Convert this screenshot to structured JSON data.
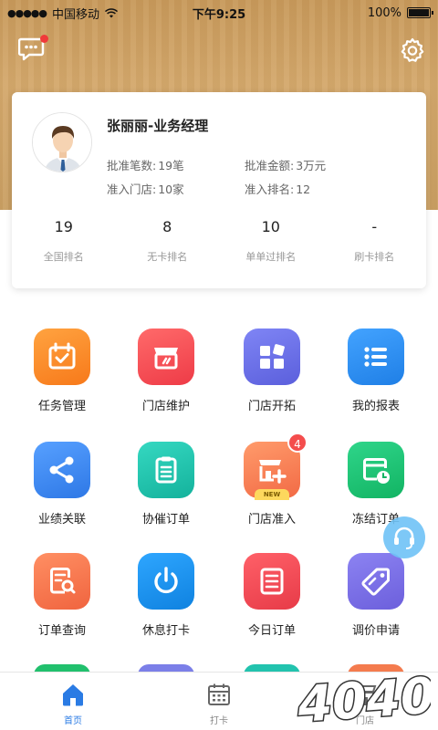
{
  "status_bar": {
    "carrier": "中国移动",
    "time": "下午9:25",
    "battery": "100%"
  },
  "profile": {
    "name_title": "张丽丽-业务经理",
    "details": [
      {
        "label": "批准笔数:",
        "value": "19笔"
      },
      {
        "label": "批准金额:",
        "value": "3万元"
      },
      {
        "label": "准入门店:",
        "value": "10家"
      },
      {
        "label": "准入排名:",
        "value": "12"
      }
    ],
    "stats": [
      {
        "value": "19",
        "label": "全国排名"
      },
      {
        "value": "8",
        "label": "无卡排名"
      },
      {
        "value": "10",
        "label": "单单过排名"
      },
      {
        "value": "-",
        "label": "刷卡排名"
      }
    ]
  },
  "grid": [
    {
      "label": "任务管理",
      "icon": "calendar-check-icon",
      "color": "#fb8c27"
    },
    {
      "label": "门店维护",
      "icon": "store-wrench-icon",
      "color": "#f2474c"
    },
    {
      "label": "门店开拓",
      "icon": "blocks-icon",
      "color": "#6a6fe6"
    },
    {
      "label": "我的报表",
      "icon": "list-icon",
      "color": "#2f8df0"
    },
    {
      "label": "业绩关联",
      "icon": "share-icon",
      "color": "#3c87ee"
    },
    {
      "label": "协催订单",
      "icon": "clipboard-icon",
      "color": "#22c3ae"
    },
    {
      "label": "门店准入",
      "icon": "store-add-icon",
      "color": "#f57a55",
      "badge": "4",
      "tag": "NEW"
    },
    {
      "label": "冻结订单",
      "icon": "calendar-clock-icon",
      "color": "#22c06f"
    },
    {
      "label": "订单查询",
      "icon": "document-search-icon",
      "color": "#f47b4e"
    },
    {
      "label": "休息打卡",
      "icon": "power-icon",
      "color": "#1e8fe8"
    },
    {
      "label": "今日订单",
      "icon": "checklist-icon",
      "color": "#ef4752"
    },
    {
      "label": "调价申请",
      "icon": "tag-icon",
      "color": "#7d6fe4"
    }
  ],
  "tabs": [
    {
      "label": "首页",
      "icon": "home-icon",
      "active": true
    },
    {
      "label": "打卡",
      "icon": "calendar-icon",
      "active": false
    },
    {
      "label": "门店",
      "icon": "store-icon",
      "active": false
    }
  ],
  "watermark": "4040"
}
